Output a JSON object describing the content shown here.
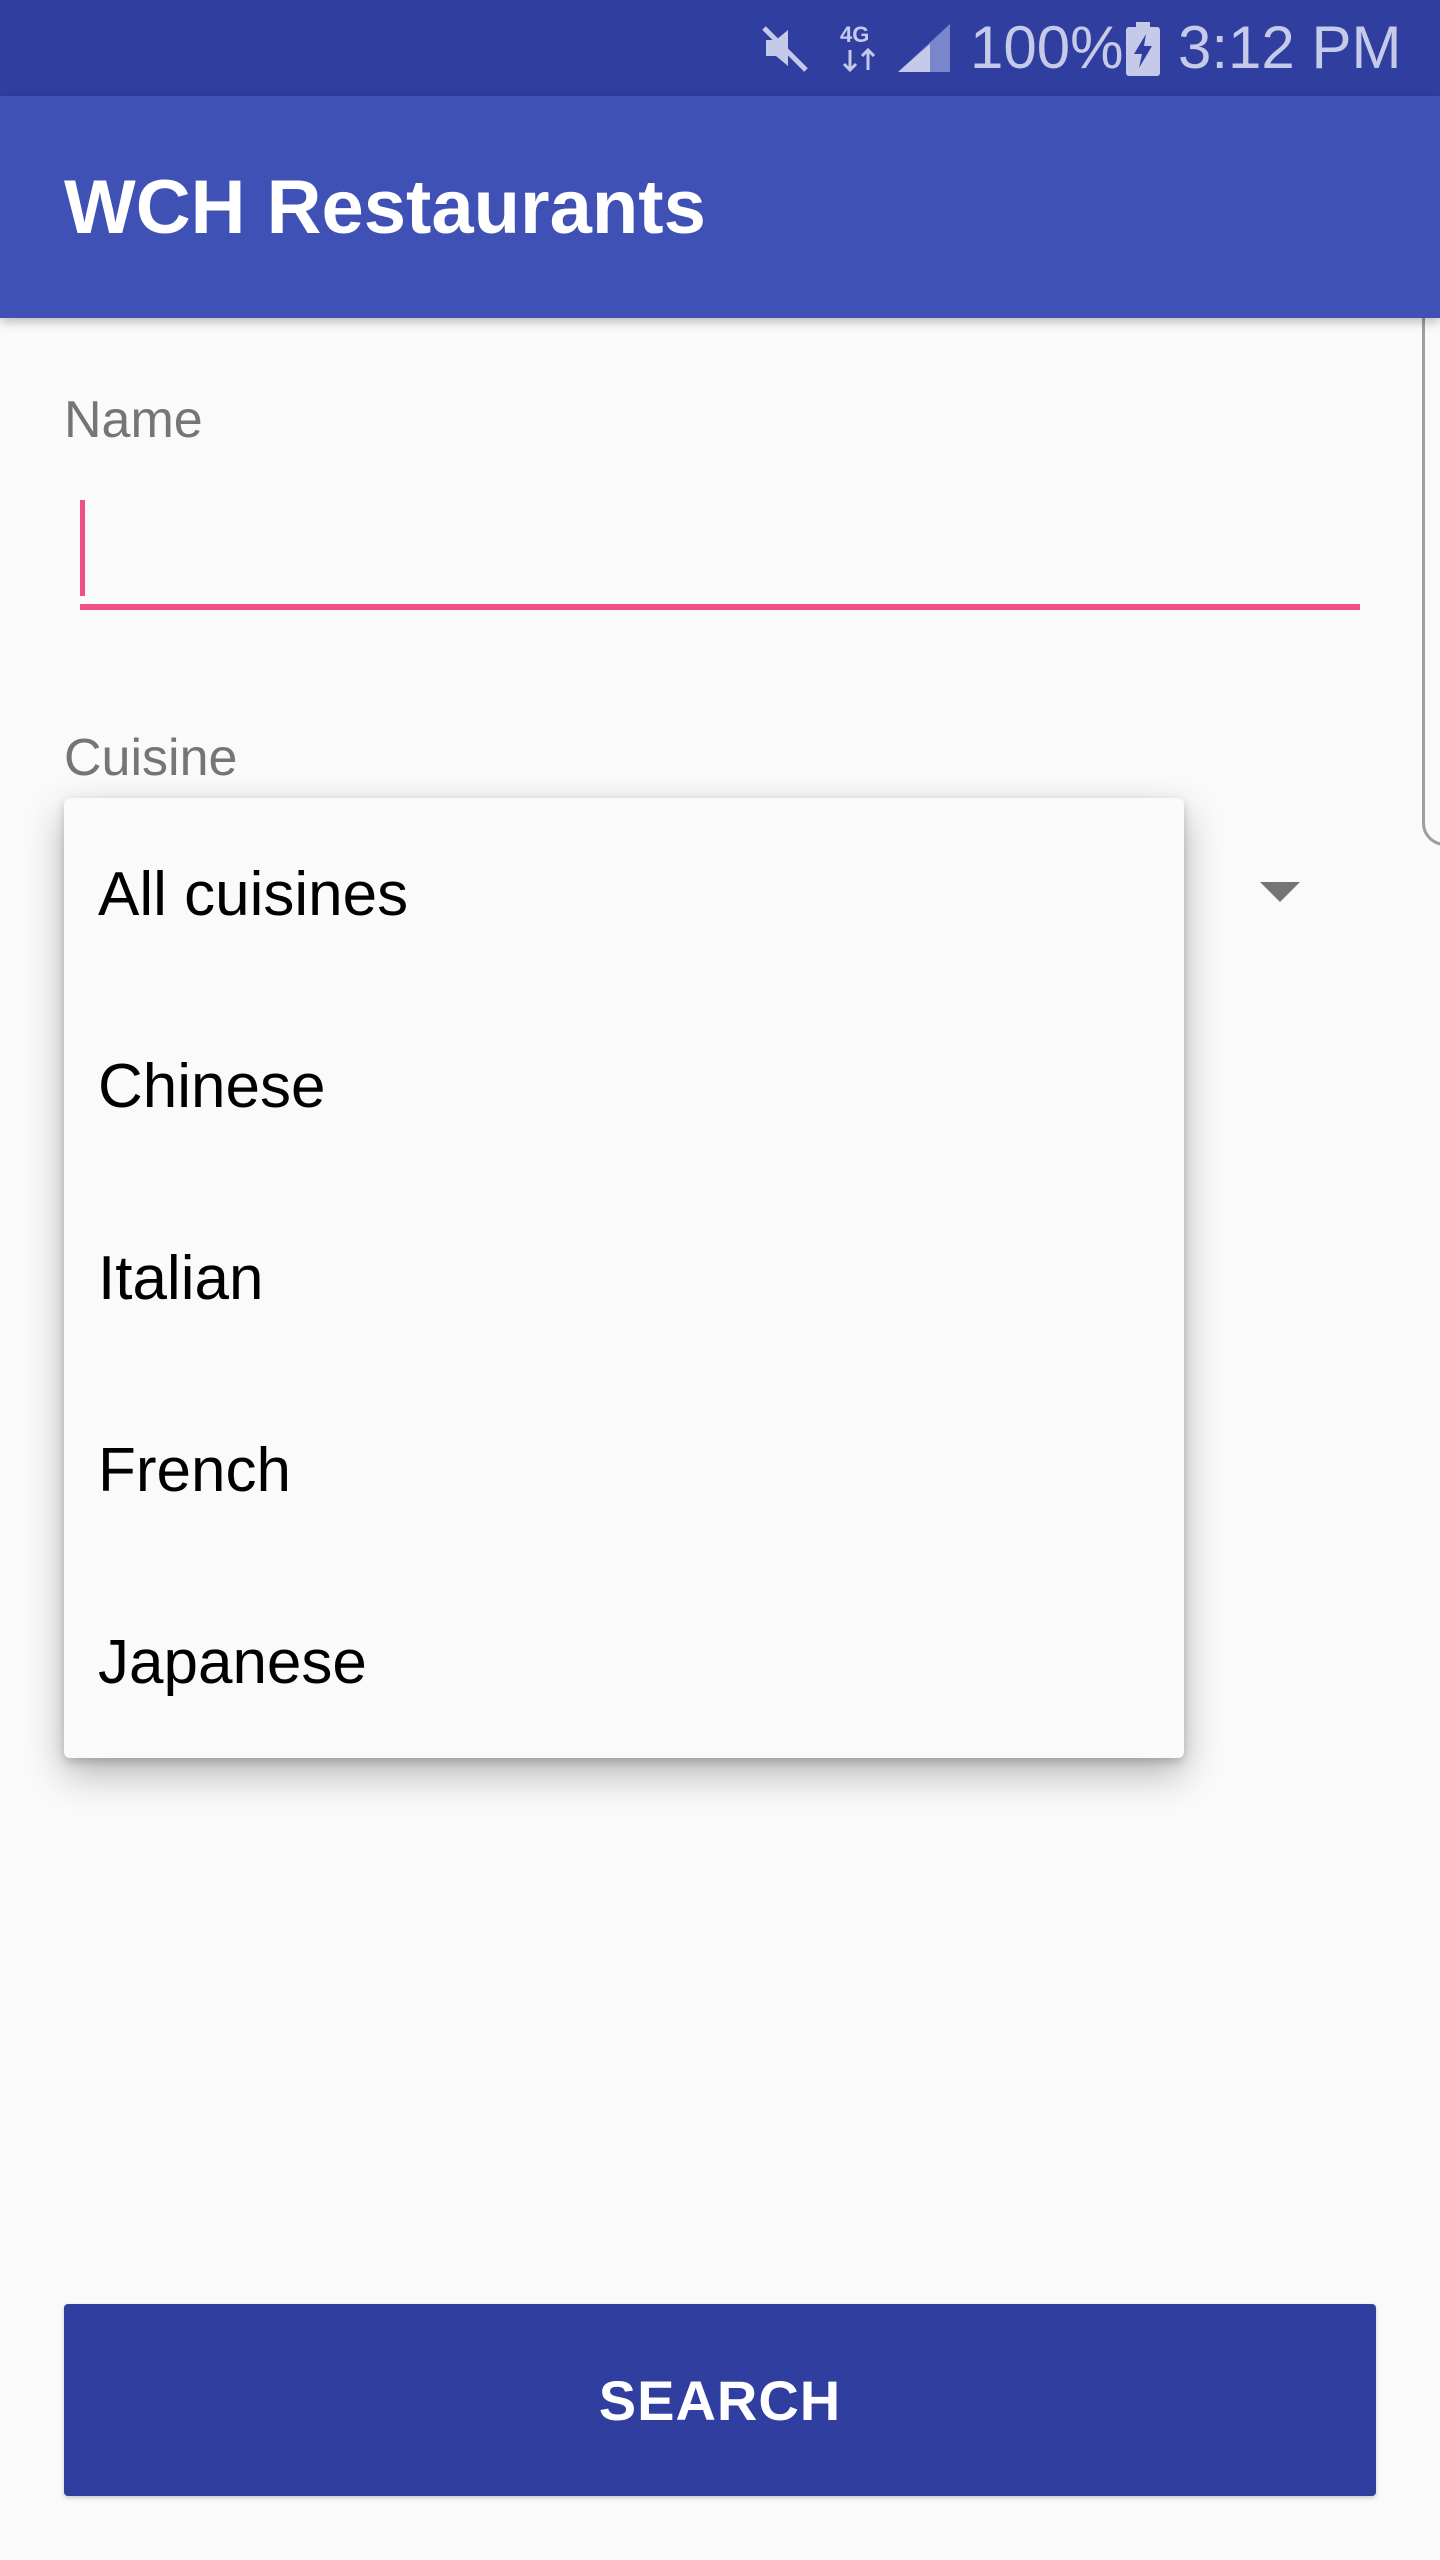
{
  "status_bar": {
    "battery_percent": "100%",
    "time": "3:12 PM",
    "icons": [
      "mute-icon",
      "4g-data-icon",
      "signal-icon",
      "battery-charging-icon"
    ],
    "network_label": "4G"
  },
  "app_bar": {
    "title": "WCH Restaurants"
  },
  "form": {
    "name_label": "Name",
    "name_value": "",
    "cuisine_label": "Cuisine"
  },
  "cuisine_dropdown": {
    "options": [
      "All cuisines",
      "Chinese",
      "Italian",
      "French",
      "Japanese"
    ]
  },
  "search_button": {
    "label": "SEARCH"
  },
  "colors": {
    "status_bar": "#303f9f",
    "app_bar": "#3f51b5",
    "accent": "#f0508a",
    "button": "#303f9f"
  }
}
